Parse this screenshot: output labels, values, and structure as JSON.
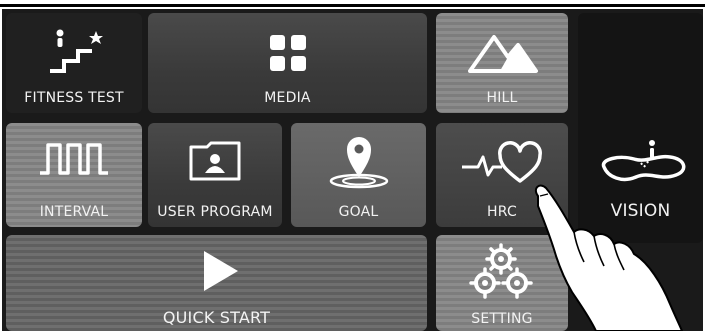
{
  "tiles": {
    "fitness_test": {
      "label": "FITNESS TEST",
      "icon": "stairs-star-icon"
    },
    "media": {
      "label": "MEDIA",
      "icon": "grid-four-squares-icon"
    },
    "hill": {
      "label": "HILL",
      "icon": "mountains-icon"
    },
    "interval": {
      "label": "INTERVAL",
      "icon": "interval-wave-icon"
    },
    "user_program": {
      "label": "USER PROGRAM",
      "icon": "user-folder-icon"
    },
    "goal": {
      "label": "GOAL",
      "icon": "map-pin-target-icon"
    },
    "hrc": {
      "label": "HRC",
      "icon": "heartbeat-heart-icon"
    },
    "vision": {
      "label": "VISION",
      "icon": "lake-path-icon"
    },
    "quick_start": {
      "label": "QUICK START",
      "icon": "play-triangle-icon"
    },
    "setting": {
      "label": "SETTING",
      "icon": "gears-icon"
    }
  },
  "overlay": {
    "icon": "pointing-hand-icon"
  },
  "colors": {
    "screen_bg": "#1a1a1a",
    "label_text": "#f2f2f2"
  }
}
